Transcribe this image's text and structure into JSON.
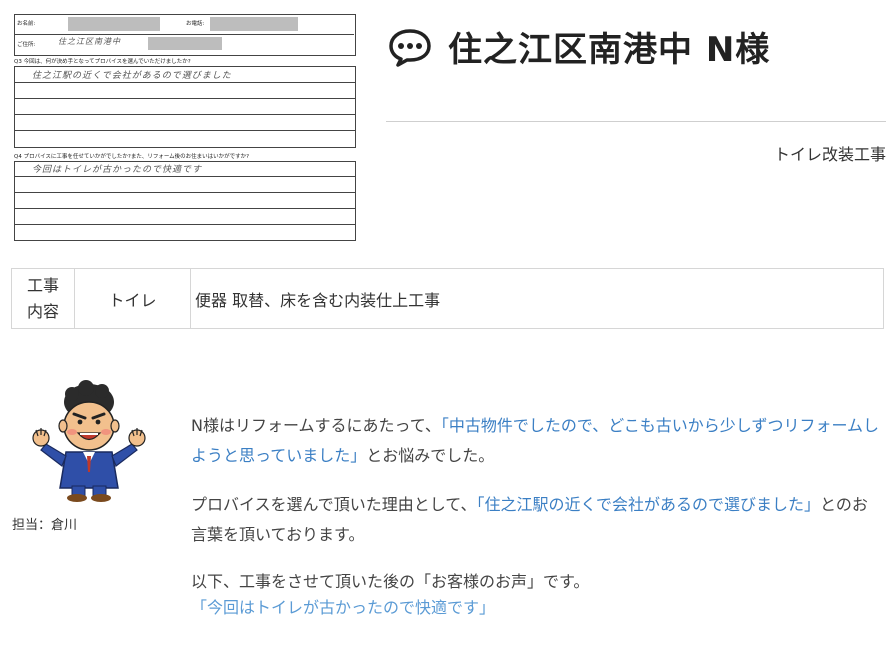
{
  "scan": {
    "name_label": "お名前:",
    "phone_label": "お電話:",
    "address_label": "ご住所:",
    "address_hand": "住之江区南港中",
    "q3": "Q3 今回は、何が決め手となってプロバイスを選んでいただけましたか?",
    "q3_answer": "住之江駅の近くで会社があるので選びました",
    "q4": "Q4 プロバイスに工事を任せていかがでしたか?また、リフォーム後のお住まいはいかがですか?",
    "q4_answer": "今回はトイレが古かったので快適です"
  },
  "header": {
    "title": "住之江区南港中 N様",
    "subtitle": "トイレ改装工事"
  },
  "work": {
    "label_line1": "工事",
    "label_line2": "内容",
    "category": "トイレ",
    "detail": "便器 取替、床を含む内装仕上工事"
  },
  "staff": {
    "label": "担当：倉川"
  },
  "content": {
    "p1_a": "N様はリフォームするにあたって、",
    "p1_q": "「中古物件でしたので、どこも古いから少しずつリフォームしようと思っていました」",
    "p1_b": "とお悩みでした。",
    "p2_a": "プロバイスを選んで頂いた理由として、",
    "p2_q": "「住之江駅の近くで会社があるので選びました」",
    "p2_b": "とのお言葉を頂いております。",
    "p3_a": "以下、工事をさせて頂いた後の「お客様のお声」です。",
    "p3_q": "「今回はトイレが古かったので快適です」"
  },
  "colors": {
    "quote_blue": "#3b7fc4",
    "voice_blue": "#5b9bd5",
    "border": "#d6d6d6"
  }
}
